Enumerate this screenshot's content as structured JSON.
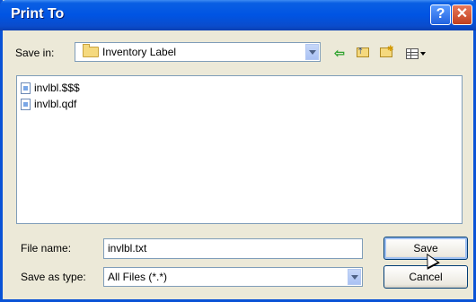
{
  "window": {
    "title": "Print To",
    "help_glyph": "?",
    "close_glyph": "✕"
  },
  "toolbar": {
    "save_in_label": "Save in:",
    "save_in_value": "Inventory Label",
    "back_icon": "back-arrow-icon",
    "up_icon": "up-one-level-icon",
    "new_folder_icon": "new-folder-icon",
    "views_icon": "views-menu-icon"
  },
  "files": [
    {
      "name": "invlbl.$$$"
    },
    {
      "name": "invlbl.qdf"
    }
  ],
  "form": {
    "file_name_label": "File name:",
    "file_name_value": "invlbl.txt",
    "save_as_type_label": "Save as type:",
    "save_as_type_value": "All Files (*.*)"
  },
  "buttons": {
    "save": "Save",
    "cancel": "Cancel"
  },
  "colors": {
    "title_bar": "#0054e3",
    "dialog_bg": "#ece9d8",
    "field_border": "#7f9db9"
  }
}
